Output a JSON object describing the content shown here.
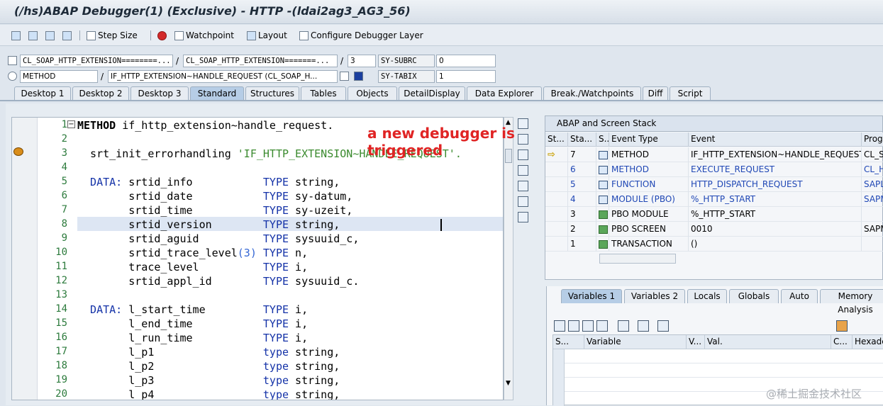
{
  "window": {
    "title": "(/hs)ABAP Debugger(1)  (Exclusive) - HTTP -(ldai2ag3_AG3_56)"
  },
  "toolbar": {
    "step_size": "Step Size",
    "watchpoint": "Watchpoint",
    "layout": "Layout",
    "configure": "Configure Debugger Layer"
  },
  "fields": {
    "program": "CL_SOAP_HTTP_EXTENSION========...",
    "include": "CL_SOAP_HTTP_EXTENSION=======...",
    "line": "3",
    "sysubrc_label": "SY-SUBRC",
    "sysubrc_value": "0",
    "event_type": "METHOD",
    "event": "IF_HTTP_EXTENSION~HANDLE_REQUEST (CL_SOAP_H...",
    "sytabix_label": "SY-TABIX",
    "sytabix_value": "1",
    "slash": "/"
  },
  "tabs": [
    "Desktop 1",
    "Desktop 2",
    "Desktop 3",
    "Standard",
    "Structures",
    "Tables",
    "Objects",
    "DetailDisplay",
    "Data Explorer",
    "Break./Watchpoints",
    "Diff",
    "Script"
  ],
  "code": {
    "lines": [
      {
        "n": "1",
        "parts": [
          {
            "t": "METHOD",
            "c": "b"
          },
          {
            "t": " if_http_extension~handle_request.",
            "c": ""
          }
        ]
      },
      {
        "n": "2",
        "parts": []
      },
      {
        "n": "3",
        "parts": [
          {
            "t": "  srt_init_errorhandling ",
            "c": ""
          },
          {
            "t": "'IF_HTTP_EXTENSION~HANDLE_REQUEST'.",
            "c": "str"
          }
        ]
      },
      {
        "n": "4",
        "parts": []
      },
      {
        "n": "5",
        "parts": [
          {
            "t": "  DATA:",
            "c": "kw"
          },
          {
            "t": " srtid_info           ",
            "c": ""
          },
          {
            "t": "TYPE",
            "c": "kw"
          },
          {
            "t": " string,",
            "c": ""
          }
        ]
      },
      {
        "n": "6",
        "parts": [
          {
            "t": "        srtid_date           ",
            "c": ""
          },
          {
            "t": "TYPE",
            "c": "kw"
          },
          {
            "t": " sy-datum,",
            "c": ""
          }
        ]
      },
      {
        "n": "7",
        "parts": [
          {
            "t": "        srtid_time           ",
            "c": ""
          },
          {
            "t": "TYPE",
            "c": "kw"
          },
          {
            "t": " sy-uzeit,",
            "c": ""
          }
        ]
      },
      {
        "n": "8",
        "parts": [
          {
            "t": "        srtid_version        ",
            "c": ""
          },
          {
            "t": "TYPE",
            "c": "kw"
          },
          {
            "t": " string,",
            "c": ""
          }
        ]
      },
      {
        "n": "9",
        "parts": [
          {
            "t": "        srtid_aguid          ",
            "c": ""
          },
          {
            "t": "TYPE",
            "c": "kw"
          },
          {
            "t": " sysuuid_c,",
            "c": ""
          }
        ]
      },
      {
        "n": "10",
        "parts": [
          {
            "t": "        srtid_trace_level",
            "c": ""
          },
          {
            "t": "(3)",
            "c": "num"
          },
          {
            "t": " ",
            "c": ""
          },
          {
            "t": "TYPE",
            "c": "kw"
          },
          {
            "t": " n,",
            "c": ""
          }
        ]
      },
      {
        "n": "11",
        "parts": [
          {
            "t": "        trace_level          ",
            "c": ""
          },
          {
            "t": "TYPE",
            "c": "kw"
          },
          {
            "t": " i,",
            "c": ""
          }
        ]
      },
      {
        "n": "12",
        "parts": [
          {
            "t": "        srtid_appl_id        ",
            "c": ""
          },
          {
            "t": "TYPE",
            "c": "kw"
          },
          {
            "t": " sysuuid_c.",
            "c": ""
          }
        ]
      },
      {
        "n": "13",
        "parts": []
      },
      {
        "n": "14",
        "parts": [
          {
            "t": "  DATA:",
            "c": "kw"
          },
          {
            "t": " l_start_time         ",
            "c": ""
          },
          {
            "t": "TYPE",
            "c": "kw"
          },
          {
            "t": " i,",
            "c": ""
          }
        ]
      },
      {
        "n": "15",
        "parts": [
          {
            "t": "        l_end_time           ",
            "c": ""
          },
          {
            "t": "TYPE",
            "c": "kw"
          },
          {
            "t": " i,",
            "c": ""
          }
        ]
      },
      {
        "n": "16",
        "parts": [
          {
            "t": "        l_run_time           ",
            "c": ""
          },
          {
            "t": "TYPE",
            "c": "kw"
          },
          {
            "t": " i,",
            "c": ""
          }
        ]
      },
      {
        "n": "17",
        "parts": [
          {
            "t": "        l_p1                 ",
            "c": ""
          },
          {
            "t": "type",
            "c": "kw"
          },
          {
            "t": " string,",
            "c": ""
          }
        ]
      },
      {
        "n": "18",
        "parts": [
          {
            "t": "        l_p2                 ",
            "c": ""
          },
          {
            "t": "type",
            "c": "kw"
          },
          {
            "t": " string,",
            "c": ""
          }
        ]
      },
      {
        "n": "19",
        "parts": [
          {
            "t": "        l_p3                 ",
            "c": ""
          },
          {
            "t": "type",
            "c": "kw"
          },
          {
            "t": " string,",
            "c": ""
          }
        ]
      },
      {
        "n": "20",
        "parts": [
          {
            "t": "        l_p4                 ",
            "c": ""
          },
          {
            "t": "type",
            "c": "kw"
          },
          {
            "t": " string,",
            "c": ""
          }
        ]
      }
    ]
  },
  "annotation": {
    "line1": "a new debugger is",
    "line2": "triggered"
  },
  "stack": {
    "title": "ABAP and Screen Stack",
    "headers": [
      "St...",
      "Sta...",
      "S...",
      "Event Type",
      "Event",
      "Progr"
    ],
    "rows": [
      {
        "cur": "⇨",
        "level": "7",
        "type": "METHOD",
        "event": "IF_HTTP_EXTENSION~HANDLE_REQUEST",
        "prog": "CL_SO",
        "link": false,
        "icon": "m"
      },
      {
        "cur": "",
        "level": "6",
        "type": "METHOD",
        "event": "EXECUTE_REQUEST",
        "prog": "CL_HT",
        "link": true,
        "icon": "m"
      },
      {
        "cur": "",
        "level": "5",
        "type": "FUNCTION",
        "event": "HTTP_DISPATCH_REQUEST",
        "prog": "SAPLH",
        "link": true,
        "icon": "m"
      },
      {
        "cur": "",
        "level": "4",
        "type": "MODULE (PBO)",
        "event": "%_HTTP_START",
        "prog": "SAPM",
        "link": true,
        "icon": "m"
      },
      {
        "cur": "",
        "level": "3",
        "type": "PBO MODULE",
        "event": "%_HTTP_START",
        "prog": "",
        "link": false,
        "icon": "g"
      },
      {
        "cur": "",
        "level": "2",
        "type": "PBO SCREEN",
        "event": "0010",
        "prog": "SAPM",
        "link": false,
        "icon": "g"
      },
      {
        "cur": "",
        "level": "1",
        "type": "TRANSACTION",
        "event": "()",
        "prog": "",
        "link": false,
        "icon": "g"
      }
    ]
  },
  "vartabs": [
    "Variables 1",
    "Variables 2",
    "Locals",
    "Globals",
    "Auto",
    "Memory Analysis"
  ],
  "vargrid": {
    "headers": [
      "S...",
      "Variable",
      "V...",
      "Val.",
      "C...",
      "Hexadec"
    ]
  },
  "watermark": "@稀土掘金技术社区"
}
